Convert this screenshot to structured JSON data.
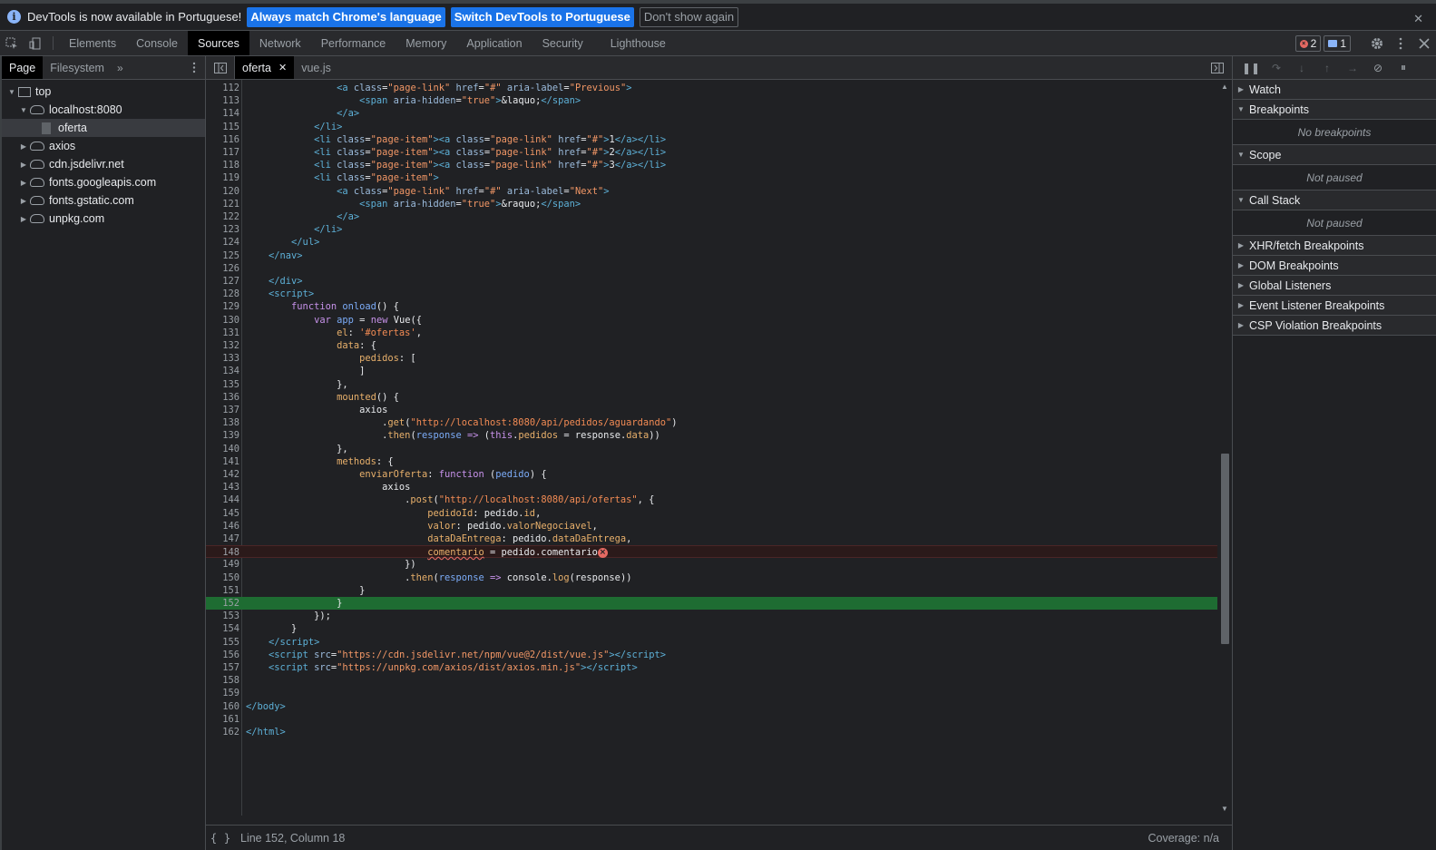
{
  "infobar": {
    "message": "DevTools is now available in Portuguese!",
    "btn_match": "Always match Chrome's language",
    "btn_switch": "Switch DevTools to Portuguese",
    "btn_dismiss": "Don't show again",
    "close": "✕"
  },
  "tabs": [
    "Elements",
    "Console",
    "Sources",
    "Network",
    "Performance",
    "Memory",
    "Application",
    "Security",
    "Lighthouse"
  ],
  "tabbar": {
    "errors": "2",
    "messages": "1"
  },
  "navigator": {
    "tab_page": "Page",
    "tab_filesystem": "Filesystem",
    "tree": [
      {
        "label": "top",
        "type": "frame",
        "depth": 0,
        "expanded": true
      },
      {
        "label": "localhost:8080",
        "type": "cloud",
        "depth": 1,
        "expanded": true
      },
      {
        "label": "oferta",
        "type": "file",
        "depth": 2,
        "selected": true
      },
      {
        "label": "axios",
        "type": "cloud",
        "depth": 1,
        "expanded": false
      },
      {
        "label": "cdn.jsdelivr.net",
        "type": "cloud",
        "depth": 1,
        "expanded": false
      },
      {
        "label": "fonts.googleapis.com",
        "type": "cloud",
        "depth": 1,
        "expanded": false
      },
      {
        "label": "fonts.gstatic.com",
        "type": "cloud",
        "depth": 1,
        "expanded": false
      },
      {
        "label": "unpkg.com",
        "type": "cloud",
        "depth": 1,
        "expanded": false
      }
    ]
  },
  "editor": {
    "tab_active": "oferta",
    "tab_other": "vue.js",
    "status_position": "Line 152, Column 18",
    "status_coverage": "Coverage: n/a",
    "error_line": 148,
    "exec_line": 152,
    "lines": [
      {
        "n": 112,
        "html": "                <span class=\"tg\">&lt;a</span> <span class=\"at\">class</span>=<span class=\"av\">\"page-link\"</span> <span class=\"at\">href</span>=<span class=\"av\">\"#\"</span> <span class=\"at\">aria-label</span>=<span class=\"av\">\"Previous\"</span><span class=\"tg\">&gt;</span>"
      },
      {
        "n": 113,
        "html": "                    <span class=\"tg\">&lt;span</span> <span class=\"at\">aria-hidden</span>=<span class=\"av\">\"true\"</span><span class=\"tg\">&gt;</span>&amp;laquo;<span class=\"tg\">&lt;/span&gt;</span>"
      },
      {
        "n": 114,
        "html": "                <span class=\"tg\">&lt;/a&gt;</span>"
      },
      {
        "n": 115,
        "html": "            <span class=\"tg\">&lt;/li&gt;</span>"
      },
      {
        "n": 116,
        "html": "            <span class=\"tg\">&lt;li</span> <span class=\"at\">class</span>=<span class=\"av\">\"page-item\"</span><span class=\"tg\">&gt;&lt;a</span> <span class=\"at\">class</span>=<span class=\"av\">\"page-link\"</span> <span class=\"at\">href</span>=<span class=\"av\">\"#\"</span><span class=\"tg\">&gt;</span>1<span class=\"tg\">&lt;/a&gt;&lt;/li&gt;</span>"
      },
      {
        "n": 117,
        "html": "            <span class=\"tg\">&lt;li</span> <span class=\"at\">class</span>=<span class=\"av\">\"page-item\"</span><span class=\"tg\">&gt;&lt;a</span> <span class=\"at\">class</span>=<span class=\"av\">\"page-link\"</span> <span class=\"at\">href</span>=<span class=\"av\">\"#\"</span><span class=\"tg\">&gt;</span>2<span class=\"tg\">&lt;/a&gt;&lt;/li&gt;</span>"
      },
      {
        "n": 118,
        "html": "            <span class=\"tg\">&lt;li</span> <span class=\"at\">class</span>=<span class=\"av\">\"page-item\"</span><span class=\"tg\">&gt;&lt;a</span> <span class=\"at\">class</span>=<span class=\"av\">\"page-link\"</span> <span class=\"at\">href</span>=<span class=\"av\">\"#\"</span><span class=\"tg\">&gt;</span>3<span class=\"tg\">&lt;/a&gt;&lt;/li&gt;</span>"
      },
      {
        "n": 119,
        "html": "            <span class=\"tg\">&lt;li</span> <span class=\"at\">class</span>=<span class=\"av\">\"page-item\"</span><span class=\"tg\">&gt;</span>"
      },
      {
        "n": 120,
        "html": "                <span class=\"tg\">&lt;a</span> <span class=\"at\">class</span>=<span class=\"av\">\"page-link\"</span> <span class=\"at\">href</span>=<span class=\"av\">\"#\"</span> <span class=\"at\">aria-label</span>=<span class=\"av\">\"Next\"</span><span class=\"tg\">&gt;</span>"
      },
      {
        "n": 121,
        "html": "                    <span class=\"tg\">&lt;span</span> <span class=\"at\">aria-hidden</span>=<span class=\"av\">\"true\"</span><span class=\"tg\">&gt;</span>&amp;raquo;<span class=\"tg\">&lt;/span&gt;</span>"
      },
      {
        "n": 122,
        "html": "                <span class=\"tg\">&lt;/a&gt;</span>"
      },
      {
        "n": 123,
        "html": "            <span class=\"tg\">&lt;/li&gt;</span>"
      },
      {
        "n": 124,
        "html": "        <span class=\"tg\">&lt;/ul&gt;</span>"
      },
      {
        "n": 125,
        "html": "    <span class=\"tg\">&lt;/nav&gt;</span>"
      },
      {
        "n": 126,
        "html": ""
      },
      {
        "n": 127,
        "html": "    <span class=\"tg\">&lt;/div&gt;</span>"
      },
      {
        "n": 128,
        "html": "    <span class=\"tg\">&lt;script&gt;</span>"
      },
      {
        "n": 129,
        "html": "        <span class=\"kw\">function</span> <span class=\"vr\">onload</span>() {"
      },
      {
        "n": 130,
        "html": "            <span class=\"kw\">var</span> <span class=\"vr\">app</span> = <span class=\"kw\">new</span> Vue({"
      },
      {
        "n": 131,
        "html": "                <span class=\"pr\">el</span>: <span class=\"st\">'#ofertas'</span>,"
      },
      {
        "n": 132,
        "html": "                <span class=\"pr\">data</span>: {"
      },
      {
        "n": 133,
        "html": "                    <span class=\"pr\">pedidos</span>: ["
      },
      {
        "n": 134,
        "html": "                    ]"
      },
      {
        "n": 135,
        "html": "                },"
      },
      {
        "n": 136,
        "html": "                <span class=\"pr\">mounted</span>() {"
      },
      {
        "n": 137,
        "html": "                    axios"
      },
      {
        "n": 138,
        "html": "                        .<span class=\"pr\">get</span>(<span class=\"st\">\"http://localhost:8080/api/pedidos/aguardando\"</span>)"
      },
      {
        "n": 139,
        "html": "                        .<span class=\"pr\">then</span>(<span class=\"vr\">response</span> <span class=\"kw\">=&gt;</span> (<span class=\"kw\">this</span>.<span class=\"pr\">pedidos</span> = response.<span class=\"pr\">data</span>))"
      },
      {
        "n": 140,
        "html": "                },"
      },
      {
        "n": 141,
        "html": "                <span class=\"pr\">methods</span>: {"
      },
      {
        "n": 142,
        "html": "                    <span class=\"pr\">enviarOferta</span>: <span class=\"kw\">function</span> (<span class=\"vr\">pedido</span>) {"
      },
      {
        "n": 143,
        "html": "                        axios"
      },
      {
        "n": 144,
        "html": "                            .<span class=\"pr\">post</span>(<span class=\"st\">\"http://localhost:8080/api/ofertas\"</span>, {"
      },
      {
        "n": 145,
        "html": "                                <span class=\"pr\">pedidoId</span>: pedido.<span class=\"pr\">id</span>,"
      },
      {
        "n": 146,
        "html": "                                <span class=\"pr\">valor</span>: pedido.<span class=\"pr\">valorNegociavel</span>,"
      },
      {
        "n": 147,
        "html": "                                <span class=\"pr\">dataDaEntrega</span>: pedido.<span class=\"pr\">dataDaEntrega</span>,"
      },
      {
        "n": 148,
        "html": "                                <span class=\"pr squiggle\">comentario</span> = pedido.comentario<span class=\"err-mark\">×</span>"
      },
      {
        "n": 149,
        "html": "                            })"
      },
      {
        "n": 150,
        "html": "                            .<span class=\"pr\">then</span>(<span class=\"vr\">response</span> <span class=\"kw\">=&gt;</span> console.<span class=\"pr\">log</span>(response))"
      },
      {
        "n": 151,
        "html": "                    }"
      },
      {
        "n": 152,
        "html": "                }"
      },
      {
        "n": 153,
        "html": "            });"
      },
      {
        "n": 154,
        "html": "        }"
      },
      {
        "n": 155,
        "html": "    <span class=\"tg\">&lt;/script&gt;</span>"
      },
      {
        "n": 156,
        "html": "    <span class=\"tg\">&lt;script</span> <span class=\"at\">src</span>=<span class=\"av\">\"https://cdn.jsdelivr.net/npm/vue@2/dist/vue.js\"</span><span class=\"tg\">&gt;&lt;/script&gt;</span>"
      },
      {
        "n": 157,
        "html": "    <span class=\"tg\">&lt;script</span> <span class=\"at\">src</span>=<span class=\"av\">\"https://unpkg.com/axios/dist/axios.min.js\"</span><span class=\"tg\">&gt;&lt;/script&gt;</span>"
      },
      {
        "n": 158,
        "html": ""
      },
      {
        "n": 159,
        "html": ""
      },
      {
        "n": 160,
        "html": "<span class=\"tg\">&lt;/body&gt;</span>"
      },
      {
        "n": 161,
        "html": ""
      },
      {
        "n": 162,
        "html": "<span class=\"tg\">&lt;/html&gt;</span>"
      }
    ]
  },
  "debugger": {
    "panes": [
      {
        "title": "Watch",
        "expanded": false
      },
      {
        "title": "Breakpoints",
        "expanded": true,
        "body": "No breakpoints"
      },
      {
        "title": "Scope",
        "expanded": true,
        "body": "Not paused"
      },
      {
        "title": "Call Stack",
        "expanded": true,
        "body": "Not paused"
      },
      {
        "title": "XHR/fetch Breakpoints",
        "expanded": false
      },
      {
        "title": "DOM Breakpoints",
        "expanded": false
      },
      {
        "title": "Global Listeners",
        "expanded": false
      },
      {
        "title": "Event Listener Breakpoints",
        "expanded": false
      },
      {
        "title": "CSP Violation Breakpoints",
        "expanded": false
      }
    ]
  },
  "colors": {
    "accent": "#1a73e8",
    "exec_line": "#1e6c32",
    "error": "#e46962"
  }
}
